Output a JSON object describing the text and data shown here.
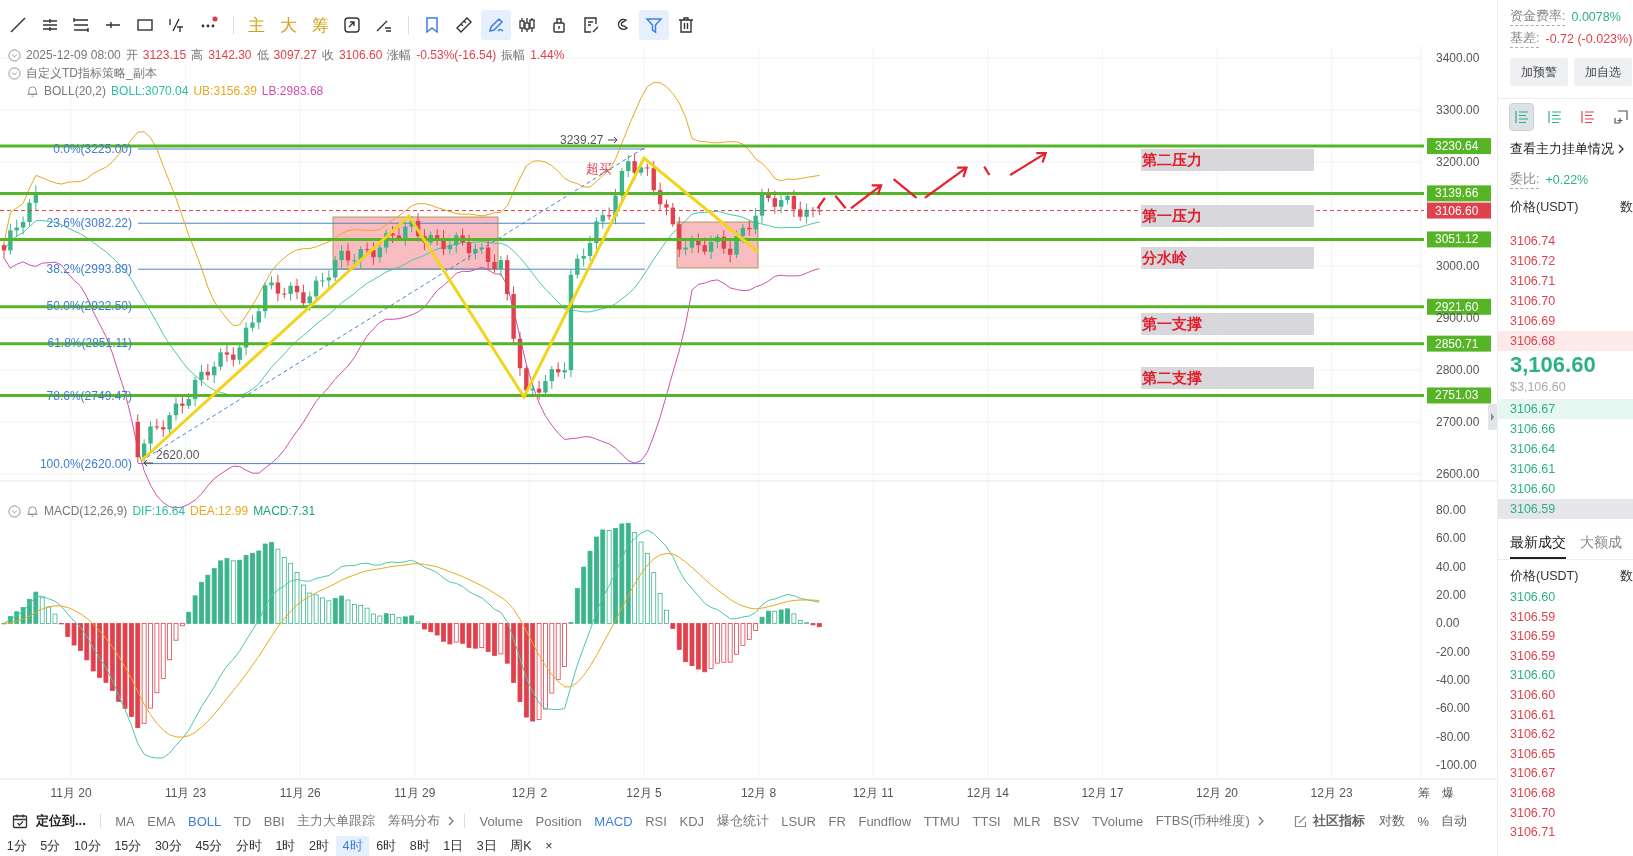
{
  "toolbar": {
    "tools": [
      {
        "kind": "icon",
        "selected": false
      },
      {
        "kind": "icon",
        "selected": false
      },
      {
        "kind": "icon",
        "selected": false
      },
      {
        "kind": "icon",
        "selected": false
      },
      {
        "kind": "icon",
        "selected": false
      },
      {
        "kind": "icon",
        "selected": false
      },
      {
        "kind": "icon",
        "selected": false
      },
      {
        "kind": "separator"
      },
      {
        "kind": "text",
        "label": "主"
      },
      {
        "kind": "text",
        "label": "大"
      },
      {
        "kind": "text",
        "label": "筹"
      },
      {
        "kind": "icon",
        "selected": false
      },
      {
        "kind": "icon",
        "selected": false
      },
      {
        "kind": "separator"
      },
      {
        "kind": "icon",
        "selected": false
      },
      {
        "kind": "icon",
        "selected": false
      },
      {
        "kind": "icon",
        "selected": true
      },
      {
        "kind": "icon",
        "selected": false
      },
      {
        "kind": "icon",
        "selected": false
      },
      {
        "kind": "icon",
        "selected": false
      },
      {
        "kind": "icon",
        "selected": false
      },
      {
        "kind": "icon",
        "selected": true
      },
      {
        "kind": "icon",
        "selected": false
      }
    ]
  },
  "ohlc": {
    "datetime": "2025-12-09 08:00",
    "fields": [
      {
        "label": "开",
        "value": "3123.15"
      },
      {
        "label": "高",
        "value": "3142.30"
      },
      {
        "label": "低",
        "value": "3097.27"
      },
      {
        "label": "收",
        "value": "3106.60"
      },
      {
        "label": "涨幅",
        "value": "-0.53%(-16.54)"
      },
      {
        "label": "振幅",
        "value": "1.44%"
      }
    ]
  },
  "strategy": {
    "name": "自定义TD指标策略_副本"
  },
  "boll": {
    "name": "BOLL(20,2)",
    "values": [
      {
        "text": "BOLL:3070.04",
        "color": "#2bbf9f"
      },
      {
        "text": "UB:3156.39",
        "color": "#e8a91c"
      },
      {
        "text": "LB:2983.68",
        "color": "#d14fae"
      }
    ]
  },
  "price_axis": [
    "3400.00",
    "3300.00",
    "3200.00",
    "3000.00",
    "2900.00",
    "2800.00",
    "2700.00",
    "2600.00"
  ],
  "levels": [
    {
      "price": "3230.64",
      "kind": "level"
    },
    {
      "price": "3139.66",
      "kind": "level"
    },
    {
      "price": "3106.60",
      "kind": "last_price"
    },
    {
      "price": "3051.12",
      "kind": "level"
    },
    {
      "price": "2921.60",
      "kind": "level"
    },
    {
      "price": "2850.71",
      "kind": "level"
    },
    {
      "price": "2751.03",
      "kind": "level"
    }
  ],
  "zones": [
    {
      "label": "第二压力"
    },
    {
      "label": "第一压力"
    },
    {
      "label": "分水岭"
    },
    {
      "label": "第一支撑"
    },
    {
      "label": "第二支撑"
    }
  ],
  "fib": [
    "0.0%(3225.00)",
    "23.6%(3082.22)",
    "38.2%(2993.89)",
    "50.0%(2922.50)",
    "61.8%(2851.11)",
    "78.6%(2749.47)",
    "100.0%(2620.00)"
  ],
  "markers": {
    "high": "3239.27",
    "low": "2620.00",
    "signal": "超买"
  },
  "macd": {
    "name": "MACD(12,26,9)",
    "values": [
      {
        "text": "DIF:16.64",
        "color": "#2bbf9f"
      },
      {
        "text": "DEA:12.99",
        "color": "#e8a91c"
      },
      {
        "text": "MACD:7.31",
        "color": "#1fa37a"
      }
    ],
    "axis": [
      "80.00",
      "60.00",
      "40.00",
      "20.00",
      "0.00",
      "-20.00",
      "-40.00",
      "-60.00",
      "-80.00",
      "-100.00"
    ]
  },
  "date_axis": [
    "11月 20",
    "11月 23",
    "11月 26",
    "11月 29",
    "12月 2",
    "12月 5",
    "12月 8",
    "12月 11",
    "12月 14",
    "12月 17",
    "12月 20",
    "12月 23"
  ],
  "axis_corner": [
    "筹",
    "爆"
  ],
  "indicator_bar": {
    "locate": "定位到...",
    "main": [
      {
        "label": "MA",
        "selected": false
      },
      {
        "label": "EMA",
        "selected": false
      },
      {
        "label": "BOLL",
        "selected": true
      },
      {
        "label": "TD",
        "selected": false
      },
      {
        "label": "BBI",
        "selected": false
      },
      {
        "label": "主力大单跟踪",
        "selected": false
      },
      {
        "label": "筹码分布",
        "selected": false
      }
    ],
    "sub": [
      {
        "label": "Volume",
        "selected": false
      },
      {
        "label": "Position",
        "selected": false
      },
      {
        "label": "MACD",
        "selected": true
      },
      {
        "label": "RSI",
        "selected": false
      },
      {
        "label": "KDJ",
        "selected": false
      },
      {
        "label": "爆仓统计",
        "selected": false
      },
      {
        "label": "LSUR",
        "selected": false
      },
      {
        "label": "FR",
        "selected": false
      },
      {
        "label": "Fundflow",
        "selected": false
      },
      {
        "label": "TTMU",
        "selected": false
      },
      {
        "label": "TTSI",
        "selected": false
      },
      {
        "label": "MLR",
        "selected": false
      },
      {
        "label": "BSV",
        "selected": false
      },
      {
        "label": "TVolume",
        "selected": false
      },
      {
        "label": "FTBS(币种维度)",
        "selected": false
      }
    ],
    "community": "社区指标",
    "options": [
      "对数",
      "%",
      "自动"
    ]
  },
  "timeframes": {
    "items": [
      {
        "label": "1分",
        "selected": false
      },
      {
        "label": "5分",
        "selected": false
      },
      {
        "label": "10分",
        "selected": false
      },
      {
        "label": "15分",
        "selected": false
      },
      {
        "label": "30分",
        "selected": false
      },
      {
        "label": "45分",
        "selected": false
      },
      {
        "label": "分时",
        "selected": false
      },
      {
        "label": "1时",
        "selected": false
      },
      {
        "label": "2时",
        "selected": false
      },
      {
        "label": "4时",
        "selected": true
      },
      {
        "label": "6时",
        "selected": false
      },
      {
        "label": "8时",
        "selected": false
      },
      {
        "label": "1日",
        "selected": false
      },
      {
        "label": "3日",
        "selected": false
      },
      {
        "label": "周K",
        "selected": false
      }
    ],
    "close": "×"
  },
  "right_panel": {
    "funding": {
      "label": "资金费率:",
      "value": "0.0078%"
    },
    "basis": {
      "label": "基差:",
      "value": "-0.72 (-0.023%)"
    },
    "buttons": [
      "加预警",
      "加自选"
    ],
    "views": [
      {
        "selected": true
      },
      {
        "selected": false
      },
      {
        "selected": false
      },
      {
        "selected": false
      }
    ],
    "link": "查看主力挂单情况",
    "ratio": {
      "label": "委比:",
      "value": "+0.22%"
    },
    "book_header": [
      "价格(USDT)",
      "数"
    ],
    "asks": [
      {
        "price": "3106.74",
        "highlighted": false
      },
      {
        "price": "3106.72",
        "highlighted": false
      },
      {
        "price": "3106.71",
        "highlighted": false
      },
      {
        "price": "3106.70",
        "highlighted": false
      },
      {
        "price": "3106.69",
        "highlighted": false
      },
      {
        "price": "3106.68",
        "highlighted": true
      }
    ],
    "last_price": "3,106.60",
    "last_price_usd": "$3,106.60",
    "bids": [
      {
        "price": "3106.67",
        "highlighted": true,
        "hovered": false
      },
      {
        "price": "3106.66",
        "highlighted": false,
        "hovered": false
      },
      {
        "price": "3106.64",
        "highlighted": false,
        "hovered": false
      },
      {
        "price": "3106.61",
        "highlighted": false,
        "hovered": false
      },
      {
        "price": "3106.60",
        "highlighted": false,
        "hovered": false
      },
      {
        "price": "3106.59",
        "highlighted": false,
        "hovered": true
      }
    ],
    "trade_tabs": [
      {
        "label": "最新成交",
        "selected": true
      },
      {
        "label": "大额成",
        "selected": false
      }
    ],
    "trades_header": [
      "价格(USDT)",
      "数"
    ],
    "trades": [
      {
        "price": "3106.60",
        "buy": true
      },
      {
        "price": "3106.59",
        "buy": false
      },
      {
        "price": "3106.59",
        "buy": false
      },
      {
        "price": "3106.59",
        "buy": false
      },
      {
        "price": "3106.60",
        "buy": true
      },
      {
        "price": "3106.60",
        "buy": false
      },
      {
        "price": "3106.61",
        "buy": false
      },
      {
        "price": "3106.62",
        "buy": false
      },
      {
        "price": "3106.65",
        "buy": false
      },
      {
        "price": "3106.67",
        "buy": false
      },
      {
        "price": "3106.68",
        "buy": false
      },
      {
        "price": "3106.70",
        "buy": false
      },
      {
        "price": "3106.71",
        "buy": false
      }
    ]
  }
}
